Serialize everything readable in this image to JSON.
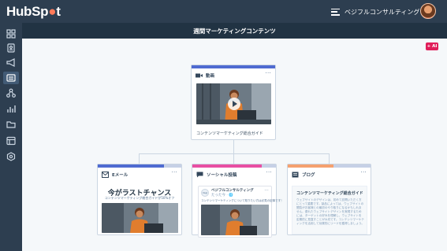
{
  "app": {
    "logo": "HubSpot",
    "logo_pre": "HubSp",
    "logo_post": "t"
  },
  "account": {
    "name": "ベジフルコンサルティング",
    "chevron": "⌄"
  },
  "subheader": {
    "title": "週間マーケティングコンテンツ"
  },
  "ai_badge": "+ AI",
  "sidebar": {
    "items": [
      {
        "name": "dashboard-icon"
      },
      {
        "name": "contacts-icon"
      },
      {
        "name": "marketing-megaphone-icon"
      },
      {
        "name": "content-icon",
        "active": true
      },
      {
        "name": "automation-icon"
      },
      {
        "name": "reports-icon"
      },
      {
        "name": "files-folder-icon"
      },
      {
        "name": "library-icon"
      },
      {
        "name": "settings-icon"
      }
    ]
  },
  "cards": {
    "video": {
      "label": "動画",
      "more": "···",
      "caption": "コンテンツマーケティング総合ガイド",
      "accent": "#4f6bd1"
    },
    "email": {
      "label": "Eメール",
      "more": "···",
      "title": "今がラストチャンス",
      "subtitle": "コンテンツマーケティング総合ガイドが50%オフ",
      "accent": "#4f6bd1",
      "accent_rest": "#c6d0e6"
    },
    "social": {
      "label": "ソーシャル投稿",
      "more": "···",
      "account_name": "ベジフルコンサルティング",
      "account_handle": "たった今 · 🌐",
      "avatar_text": "Vegi",
      "post_text": "コンテンツマーケティングについて知りたい方は必見の記事です！",
      "accent": "#e84fa3",
      "accent_rest": "#c6d0e6"
    },
    "blog": {
      "label": "ブログ",
      "more": "···",
      "title": "コンテンツマーケティング総合ガイド",
      "body": "ウェブサイトのデザインは、初めて訪問いただく方にとって重要です。製品によっては、ウェブサイトの閲覧がお客様との最初のやり取りになるかもしれません。優れたウェブサイトデザインを実現するためには、ターゲットの好みを理解し、ウェブサイトを定期的に見直すことが大切です。コンテンツマーケティングを活用して効果的にリードを獲得しましょう。",
      "accent": "#f5a16f",
      "accent_rest": "#c6d0e6"
    }
  },
  "colors": {
    "nav": "#2d3e50",
    "subheader": "#213343",
    "background": "#f5f8fa",
    "brand_orange": "#ff7a59"
  }
}
